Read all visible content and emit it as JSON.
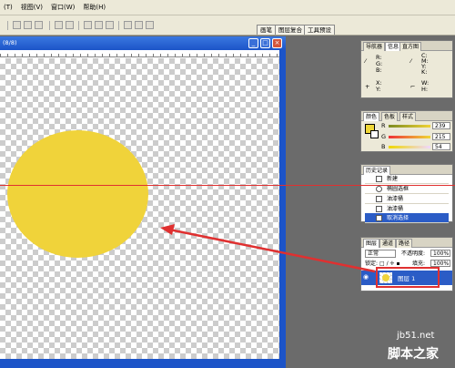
{
  "menubar": {
    "items": [
      "(T)",
      "视图(V)",
      "窗口(W)",
      "帮助(H)"
    ]
  },
  "palette_well": {
    "tabs": [
      "画笔",
      "图层复合",
      "工具预设"
    ]
  },
  "document": {
    "title": "(8/8)"
  },
  "navigator_panel": {
    "tabs": [
      "导航器",
      "信息",
      "直方图"
    ],
    "info_left": [
      "R:",
      "G:",
      "B:"
    ],
    "info_right": [
      "C:",
      "M:",
      "Y:",
      "K:"
    ],
    "xy": [
      "X:",
      "Y:"
    ],
    "wh": [
      "W:",
      "H:"
    ]
  },
  "color_panel": {
    "tabs": [
      "颜色",
      "色板",
      "样式"
    ],
    "channels": [
      {
        "label": "R",
        "value": "239"
      },
      {
        "label": "G",
        "value": "215"
      },
      {
        "label": "B",
        "value": "54"
      }
    ],
    "foreground_color": "#efd736"
  },
  "history_panel": {
    "title": "历史记录",
    "items": [
      "新建",
      "椭圆选框",
      "油漆桶",
      "油漆桶",
      "取消选择"
    ],
    "selected_index": 4
  },
  "layers_panel": {
    "tabs": [
      "图层",
      "通道",
      "路径"
    ],
    "blend_mode": "正常",
    "opacity_label": "不透明度:",
    "opacity_value": "100%",
    "lock_label": "锁定:",
    "fill_label": "填充:",
    "fill_value": "100%",
    "layer_name": "图层 1"
  },
  "canvas": {
    "shape_color": "#f0d33a",
    "guide_color": "#e03030"
  },
  "watermark": {
    "line1": "jb51.net",
    "line2": "脚本之家"
  }
}
